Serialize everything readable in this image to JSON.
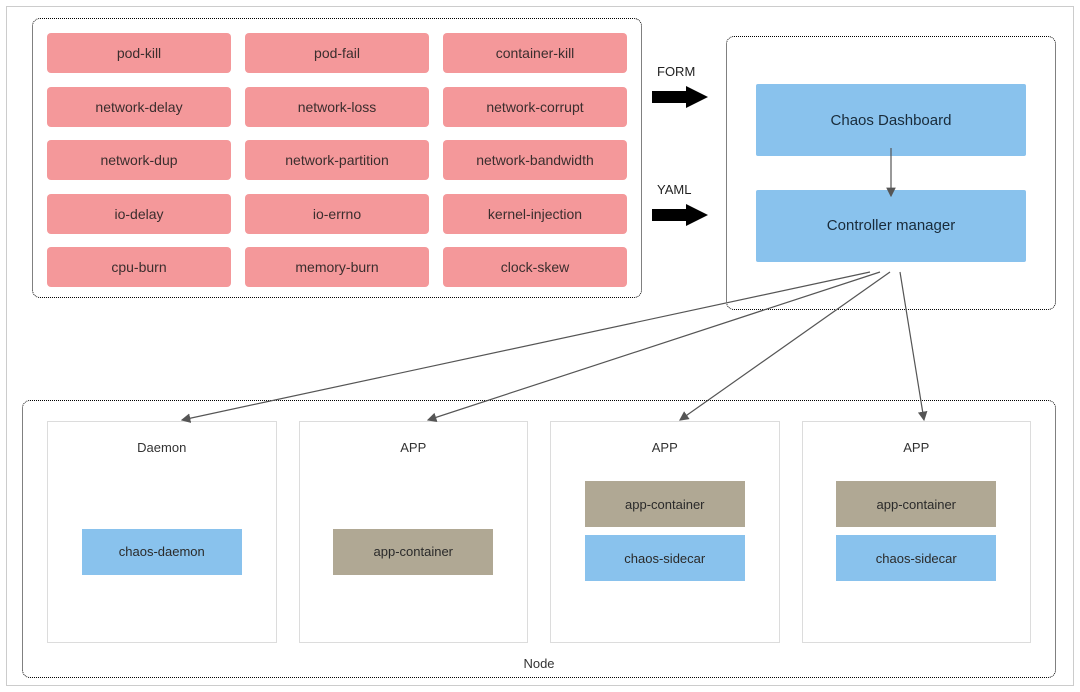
{
  "chaos_types": {
    "rows": [
      [
        "pod-kill",
        "pod-fail",
        "container-kill"
      ],
      [
        "network-delay",
        "network-loss",
        "network-corrupt"
      ],
      [
        "network-dup",
        "network-partition",
        "network-bandwidth"
      ],
      [
        "io-delay",
        "io-errno",
        "kernel-injection"
      ],
      [
        "cpu-burn",
        "memory-burn",
        "clock-skew"
      ]
    ]
  },
  "input_labels": {
    "form": "FORM",
    "yaml": "YAML"
  },
  "control_plane": {
    "dashboard": "Chaos Dashboard",
    "controller": "Controller manager"
  },
  "node": {
    "label": "Node",
    "pods": [
      {
        "title": "Daemon",
        "containers": [
          {
            "label": "chaos-daemon",
            "color": "blue"
          }
        ],
        "center": true
      },
      {
        "title": "APP",
        "containers": [
          {
            "label": "app-container",
            "color": "tan"
          }
        ],
        "center": true
      },
      {
        "title": "APP",
        "containers": [
          {
            "label": "app-container",
            "color": "tan"
          },
          {
            "label": "chaos-sidecar",
            "color": "blue"
          }
        ],
        "center": false
      },
      {
        "title": "APP",
        "containers": [
          {
            "label": "app-container",
            "color": "tan"
          },
          {
            "label": "chaos-sidecar",
            "color": "blue"
          }
        ],
        "center": false
      }
    ]
  }
}
